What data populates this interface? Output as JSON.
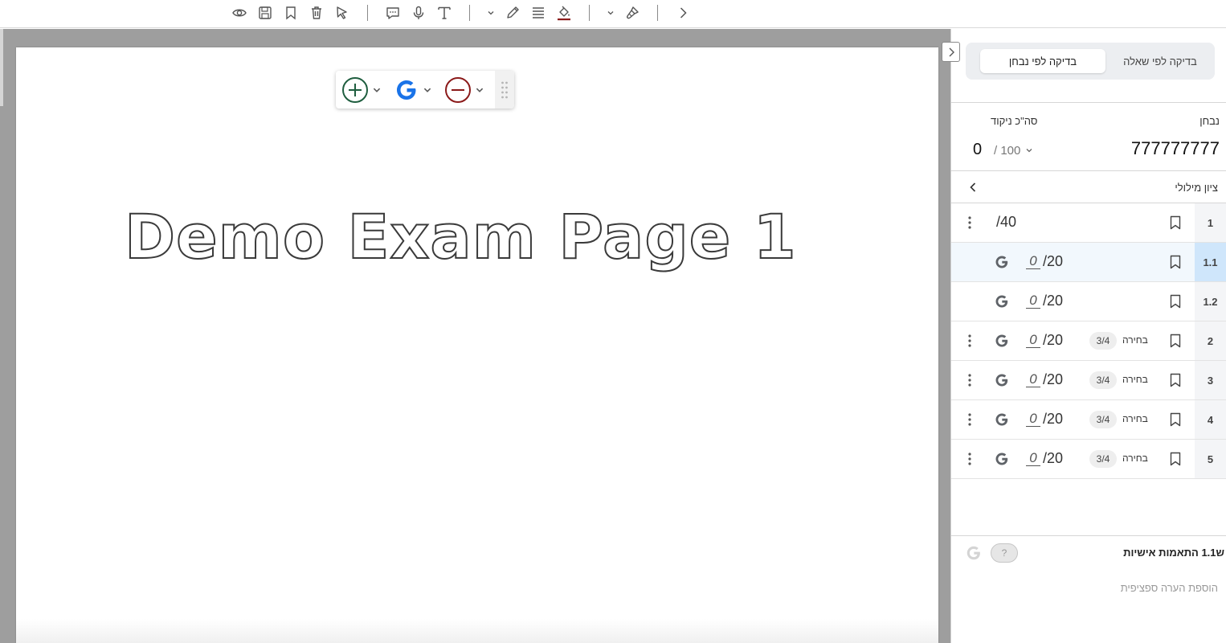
{
  "toolbar": {
    "icons": [
      "eye-icon",
      "save-icon",
      "bookmark-icon",
      "trash-icon",
      "cursor-icon",
      "comment-icon",
      "microphone-icon",
      "text-icon",
      "pen-icon",
      "lines-icon",
      "fill-icon",
      "brush-icon",
      "chevron-right-icon"
    ]
  },
  "document": {
    "page_title": "Demo Exam Page 1"
  },
  "floating_toolbar": {
    "icons": [
      "plus-circle-icon",
      "google-icon",
      "minus-circle-icon"
    ],
    "colors": {
      "plus": "#1f5e3f",
      "google": "#1a73e8",
      "minus": "#8b1a1a"
    }
  },
  "panel": {
    "mode_toggle": {
      "by_question": "בדיקה לפי שאלה",
      "by_examinee": "בדיקה לפי נבחן"
    },
    "examinee_label": "נבחן",
    "examinee_id": "777777777",
    "total_score_label": "סה\"כ ניקוד",
    "total_score": "0",
    "total_max": "/ 100",
    "verbal_grade_label": "ציון מילולי",
    "questions": [
      {
        "num": "1",
        "score": "",
        "max": "/40",
        "badge": "",
        "choice": "",
        "has_g": false,
        "has_kebab": true,
        "selected": false
      },
      {
        "num": "1.1",
        "score": "0",
        "max": "/20",
        "badge": "",
        "choice": "",
        "has_g": true,
        "has_kebab": false,
        "selected": true
      },
      {
        "num": "1.2",
        "score": "0",
        "max": "/20",
        "badge": "",
        "choice": "",
        "has_g": true,
        "has_kebab": false,
        "selected": false
      },
      {
        "num": "2",
        "score": "0",
        "max": "/20",
        "badge": "3/4",
        "choice": "בחירה",
        "has_g": true,
        "has_kebab": true,
        "selected": false
      },
      {
        "num": "3",
        "score": "0",
        "max": "/20",
        "badge": "3/4",
        "choice": "בחירה",
        "has_g": true,
        "has_kebab": true,
        "selected": false
      },
      {
        "num": "4",
        "score": "0",
        "max": "/20",
        "badge": "3/4",
        "choice": "בחירה",
        "has_g": true,
        "has_kebab": true,
        "selected": false
      },
      {
        "num": "5",
        "score": "0",
        "max": "/20",
        "badge": "3/4",
        "choice": "בחירה",
        "has_g": true,
        "has_kebab": true,
        "selected": false
      }
    ],
    "footer": {
      "title": "ש1.1 התאמות אישיות",
      "help_label": "?",
      "comment_placeholder": "הוספת הערה ספציפית"
    },
    "colors": {
      "selected_row": "#f2f8fd",
      "selected_num": "#cfe6fb"
    }
  }
}
